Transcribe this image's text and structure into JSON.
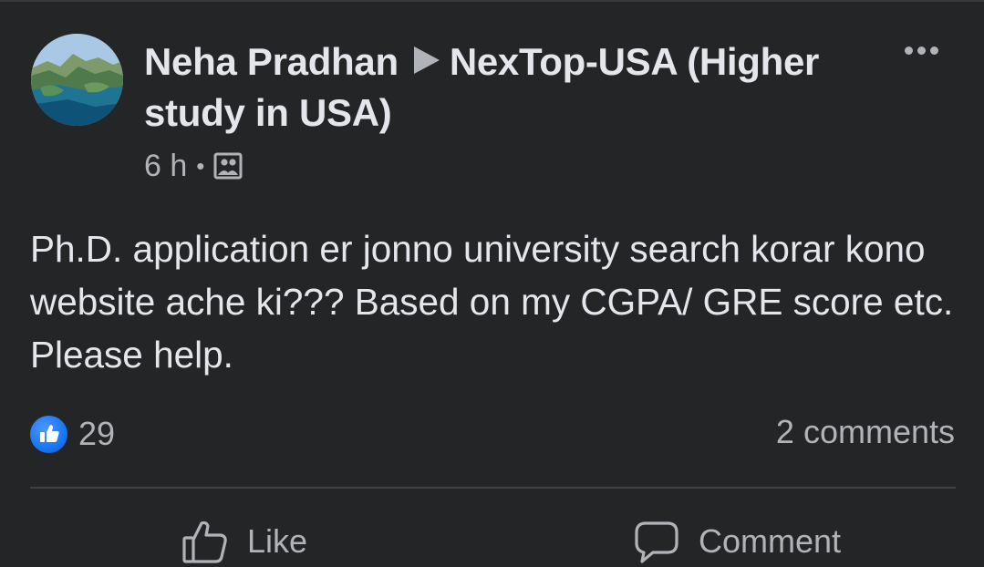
{
  "post": {
    "author": "Neha Pradhan",
    "group": "NexTop-USA (Higher study in USA)",
    "time": "6 h",
    "separator": "•",
    "audience_icon": "group-audience-icon",
    "more_icon": "more-options-icon",
    "text": "Ph.D. application er jonno university search korar kono website ache ki??? Based on my CGPA/ GRE score etc. Please help."
  },
  "stats": {
    "reaction_icon": "like-reaction-icon",
    "reaction_count": "29",
    "comments": "2 comments"
  },
  "actions": {
    "like_label": "Like",
    "comment_label": "Comment"
  },
  "colors": {
    "background": "#242526",
    "text_primary": "#e4e6eb",
    "text_secondary": "#b0b3b8",
    "like_blue": "#1877f2"
  }
}
